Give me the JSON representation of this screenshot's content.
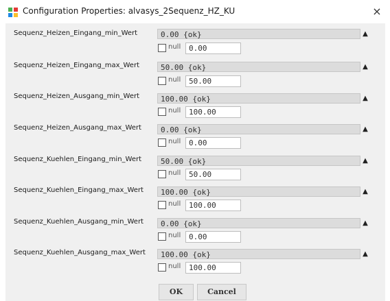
{
  "window": {
    "title": "Configuration Properties: alvasys_2Sequenz_HZ_KU",
    "close_glyph": "×",
    "app_icon": "config-app-icon"
  },
  "expand_glyph": "▲",
  "null_label": "null",
  "properties": [
    {
      "label": "Sequenz_Heizen_Eingang_min_Wert",
      "status": "0.00 {ok}",
      "value": "0.00"
    },
    {
      "label": "Sequenz_Heizen_Eingang_max_Wert",
      "status": "50.00 {ok}",
      "value": "50.00"
    },
    {
      "label": "Sequenz_Heizen_Ausgang_min_Wert",
      "status": "100.00 {ok}",
      "value": "100.00"
    },
    {
      "label": "Sequenz_Heizen_Ausgang_max_Wert",
      "status": "0.00 {ok}",
      "value": "0.00"
    },
    {
      "label": "Sequenz_Kuehlen_Eingang_min_Wert",
      "status": "50.00 {ok}",
      "value": "50.00"
    },
    {
      "label": "Sequenz_Kuehlen_Eingang_max_Wert",
      "status": "100.00 {ok}",
      "value": "100.00"
    },
    {
      "label": "Sequenz_Kuehlen_Ausgang_min_Wert",
      "status": "0.00 {ok}",
      "value": "0.00"
    },
    {
      "label": "Sequenz_Kuehlen_Ausgang_max_Wert",
      "status": "100.00 {ok}",
      "value": "100.00"
    }
  ],
  "buttons": {
    "ok": "OK",
    "cancel": "Cancel"
  }
}
